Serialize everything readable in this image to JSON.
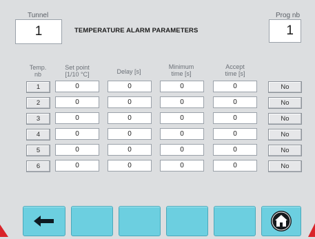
{
  "header": {
    "tunnel_label": "Tunnel",
    "tunnel_value": "1",
    "title": "TEMPERATURE ALARM PARAMETERS",
    "prog_label": "Prog nb",
    "prog_value": "1"
  },
  "columns": {
    "temp_nb": "Temp.\nnb",
    "set_point": "Set point\n[1/10 °C]",
    "delay": "Delay [s]",
    "minimum_time": "Minimum\ntime [s]",
    "accept_time": "Accept\ntime [s]"
  },
  "rows": [
    {
      "nb": "1",
      "set_point": "0",
      "delay": "0",
      "min_time": "0",
      "accept_time": "0",
      "state": "No"
    },
    {
      "nb": "2",
      "set_point": "0",
      "delay": "0",
      "min_time": "0",
      "accept_time": "0",
      "state": "No"
    },
    {
      "nb": "3",
      "set_point": "0",
      "delay": "0",
      "min_time": "0",
      "accept_time": "0",
      "state": "No"
    },
    {
      "nb": "4",
      "set_point": "0",
      "delay": "0",
      "min_time": "0",
      "accept_time": "0",
      "state": "No"
    },
    {
      "nb": "5",
      "set_point": "0",
      "delay": "0",
      "min_time": "0",
      "accept_time": "0",
      "state": "No"
    },
    {
      "nb": "6",
      "set_point": "0",
      "delay": "0",
      "min_time": "0",
      "accept_time": "0",
      "state": "No"
    }
  ],
  "footer": {
    "buttons": [
      "back-arrow-icon",
      "",
      "",
      "",
      "",
      "home-icon"
    ]
  },
  "colors": {
    "background": "#dcdee0",
    "button_accent": "#6ccfe0",
    "corner_marker": "#d9242a"
  }
}
